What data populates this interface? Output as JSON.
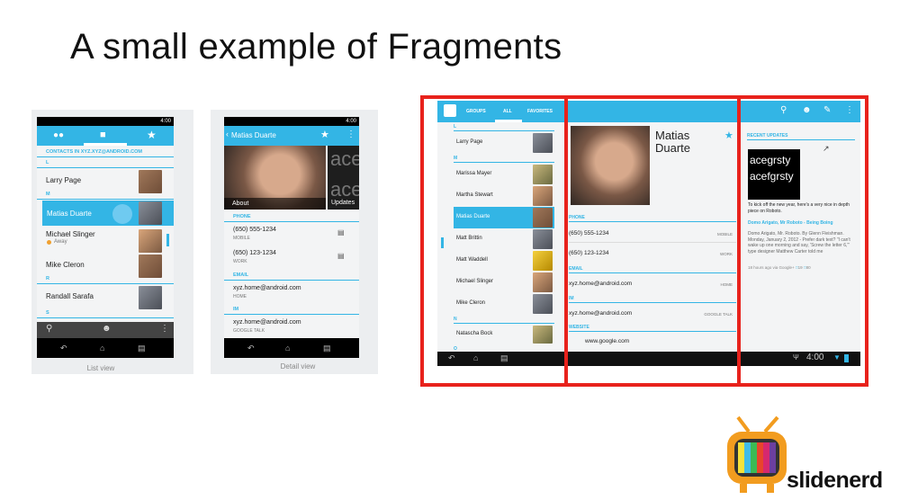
{
  "slide": {
    "title": "A small example of Fragments"
  },
  "list_phone": {
    "status_time": "4:00",
    "section_header": "CONTACTS IN XYZ.XYZ@ANDROID.COM",
    "sections": [
      "L",
      "M",
      "R",
      "S"
    ],
    "contacts": [
      {
        "name": "Larry Page",
        "sub": ""
      },
      {
        "name": "Matias Duarte",
        "sub": ""
      },
      {
        "name": "Michael Slinger",
        "sub": "Away"
      },
      {
        "name": "Mike Cleron",
        "sub": ""
      },
      {
        "name": "Randall Sarafa",
        "sub": ""
      }
    ],
    "caption": "List view"
  },
  "detail_phone": {
    "status_time": "4:00",
    "name": "Matias Duarte",
    "tab_about": "About",
    "tab_updates": "Updates",
    "side_text": [
      "ace",
      "ace"
    ],
    "phone_header": "PHONE",
    "phones": [
      {
        "number": "(650) 555-1234",
        "label": "MOBILE"
      },
      {
        "number": "(650) 123-1234",
        "label": "WORK"
      }
    ],
    "email_header": "EMAIL",
    "email": {
      "value": "xyz.home@android.com",
      "label": "HOME"
    },
    "im_header": "IM",
    "im": {
      "value": "xyz.home@android.com",
      "label": "GOOGLE TALK"
    },
    "caption": "Detail view"
  },
  "tablet": {
    "tabs": [
      "GROUPS",
      "ALL",
      "FAVORITES"
    ],
    "list_sections": [
      "L",
      "M",
      "N",
      "O"
    ],
    "contacts": [
      "Larry Page",
      "Marissa Mayer",
      "Martha Stewart",
      "Matias Duarte",
      "Matt Brittin",
      "Matt Waddell",
      "Michael Slinger",
      "Mike Cleron",
      "Natascha Bock"
    ],
    "name_line1": "Matias",
    "name_line2": "Duarte",
    "phone_header": "PHONE",
    "phones": [
      {
        "number": "(650) 555-1234",
        "label": "MOBILE"
      },
      {
        "number": "(650) 123-1234",
        "label": "WORK"
      }
    ],
    "email_header": "EMAIL",
    "email": {
      "value": "xyz.home@android.com",
      "label": "HOME"
    },
    "im_header": "IM",
    "im": {
      "value": "xyz.home@android.com",
      "label": "GOOGLE TALK"
    },
    "website_header": "WEBSITE",
    "website": "www.google.com",
    "recent_header": "RECENT UPDATES",
    "font_sample": [
      "acegrsty",
      "acefgrsty"
    ],
    "update_text": "To kick off the new year, here's a very nice in depth piece on Roboto.",
    "update_link": "Domo Arigato, Mr Roboto - Being Boing",
    "update_body": "Domo Arigato, Mr. Roboto. By Glenn Fleishman. Monday, January 2, 2012 - Prefer dark text? \"I can't wake up one morning and say, 'Screw the letter 6,'\" type designer Matthew Carter told me",
    "update_meta": "18 hours ago via Google+",
    "update_counts": [
      "19",
      "80"
    ],
    "time": "4:00"
  },
  "logo": {
    "text": "slidenerd"
  }
}
